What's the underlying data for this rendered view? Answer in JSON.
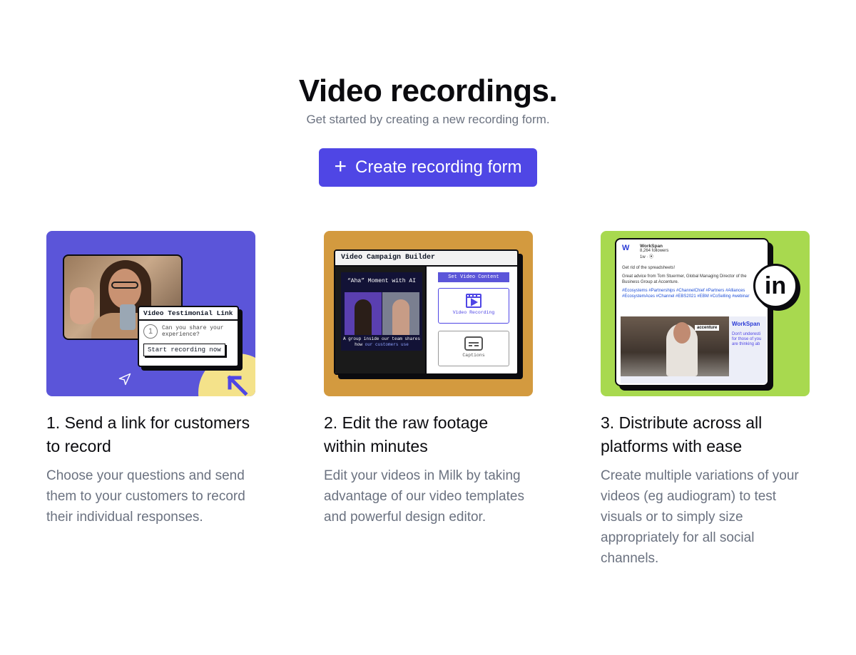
{
  "header": {
    "title": "Video recordings.",
    "subtitle": "Get started by creating a new recording form.",
    "cta_label": "Create recording form",
    "cta_icon": "plus-icon"
  },
  "colors": {
    "accent": "#4f46e5",
    "card1_bg": "#5b55d9",
    "card2_bg": "#d39a3f",
    "card3_bg": "#a8d94f"
  },
  "cards": [
    {
      "title": "1. Send a link for customers to record",
      "description": "Choose your questions and send them to your customers to record their individual responses.",
      "illustration": {
        "popup_title": "Video Testimonial Link",
        "question_number": "1",
        "question_text": "Can you share your experience?",
        "button_label": "Start recording now"
      }
    },
    {
      "title": "2. Edit the raw footage within minutes",
      "description": "Edit your videos in Milk by taking advantage of our video templates and powerful design editor.",
      "illustration": {
        "window_title": "Video Campaign Builder",
        "video_title": "“Aha” Moment with AI",
        "caption_text": "A group inside our team shares how",
        "caption_highlight": "our customers use",
        "panel_button": "Set Video Content",
        "option_1": "Video Recording",
        "option_2": "Captions"
      }
    },
    {
      "title": "3. Distribute across all platforms with ease",
      "description": "Create multiple variations of your videos (eg audiogram) to test visuals or to simply size appropriately for all social channels.",
      "illustration": {
        "company": "WorkSpan",
        "followers": "8,264 followers",
        "post_time": "1w · ⦿",
        "post_line1": "Get rid of the spreadsheets!",
        "post_line2": "Great advice from Tom Stuermer, Global Managing Director of the Business Group at Accenture.",
        "hashtags": "#Ecosystems #Partnerships #ChannelChief #Partners #Alliances #EcosystemAces #Channel #EBS2021 #EBM #CoSelling #webinar",
        "video_tag": "accenture",
        "brand_mark": "WorkSpan",
        "side_text": "Don't underesti for those of you are thinking ab",
        "social_badge": "in"
      }
    }
  ]
}
